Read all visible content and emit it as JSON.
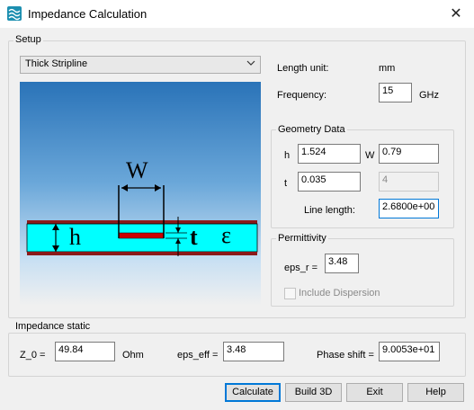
{
  "window": {
    "title": "Impedance Calculation",
    "close_symbol": "✕"
  },
  "setup": {
    "label": "Setup",
    "type_selected": "Thick Stripline",
    "length_unit_label": "Length unit:",
    "length_unit_value": "mm",
    "frequency_label": "Frequency:",
    "frequency_value": "15",
    "frequency_unit": "GHz"
  },
  "diagram": {
    "w_label": "W",
    "h_label": "h",
    "t_label": "t",
    "eps_label": "ε"
  },
  "geometry": {
    "label": "Geometry Data",
    "h_label": "h",
    "h_value": "1.524",
    "w_label": "W",
    "w_value": "0.79",
    "t_label": "t",
    "t_value": "0.035",
    "disabled_value": "4",
    "line_length_label": "Line length:",
    "line_length_value": "2.6800e+00"
  },
  "permittivity": {
    "label": "Permittivity",
    "eps_r_label": "eps_r =",
    "eps_r_value": "3.48",
    "dispersion_label": "Include Dispersion"
  },
  "impedance": {
    "label": "Impedance static",
    "z0_label": "Z_0 =",
    "z0_value": "49.84",
    "z0_unit": "Ohm",
    "eps_eff_label": "eps_eff =",
    "eps_eff_value": "3.48",
    "phase_shift_label": "Phase shift =",
    "phase_shift_value": "9.0053e+01"
  },
  "buttons": {
    "calculate": "Calculate",
    "build3d": "Build 3D",
    "exit": "Exit",
    "help": "Help"
  },
  "colors": {
    "dielectric": "#00ffff",
    "strip": "#cc0000",
    "ground": "#8b1a1a",
    "accent": "#0078d7"
  }
}
